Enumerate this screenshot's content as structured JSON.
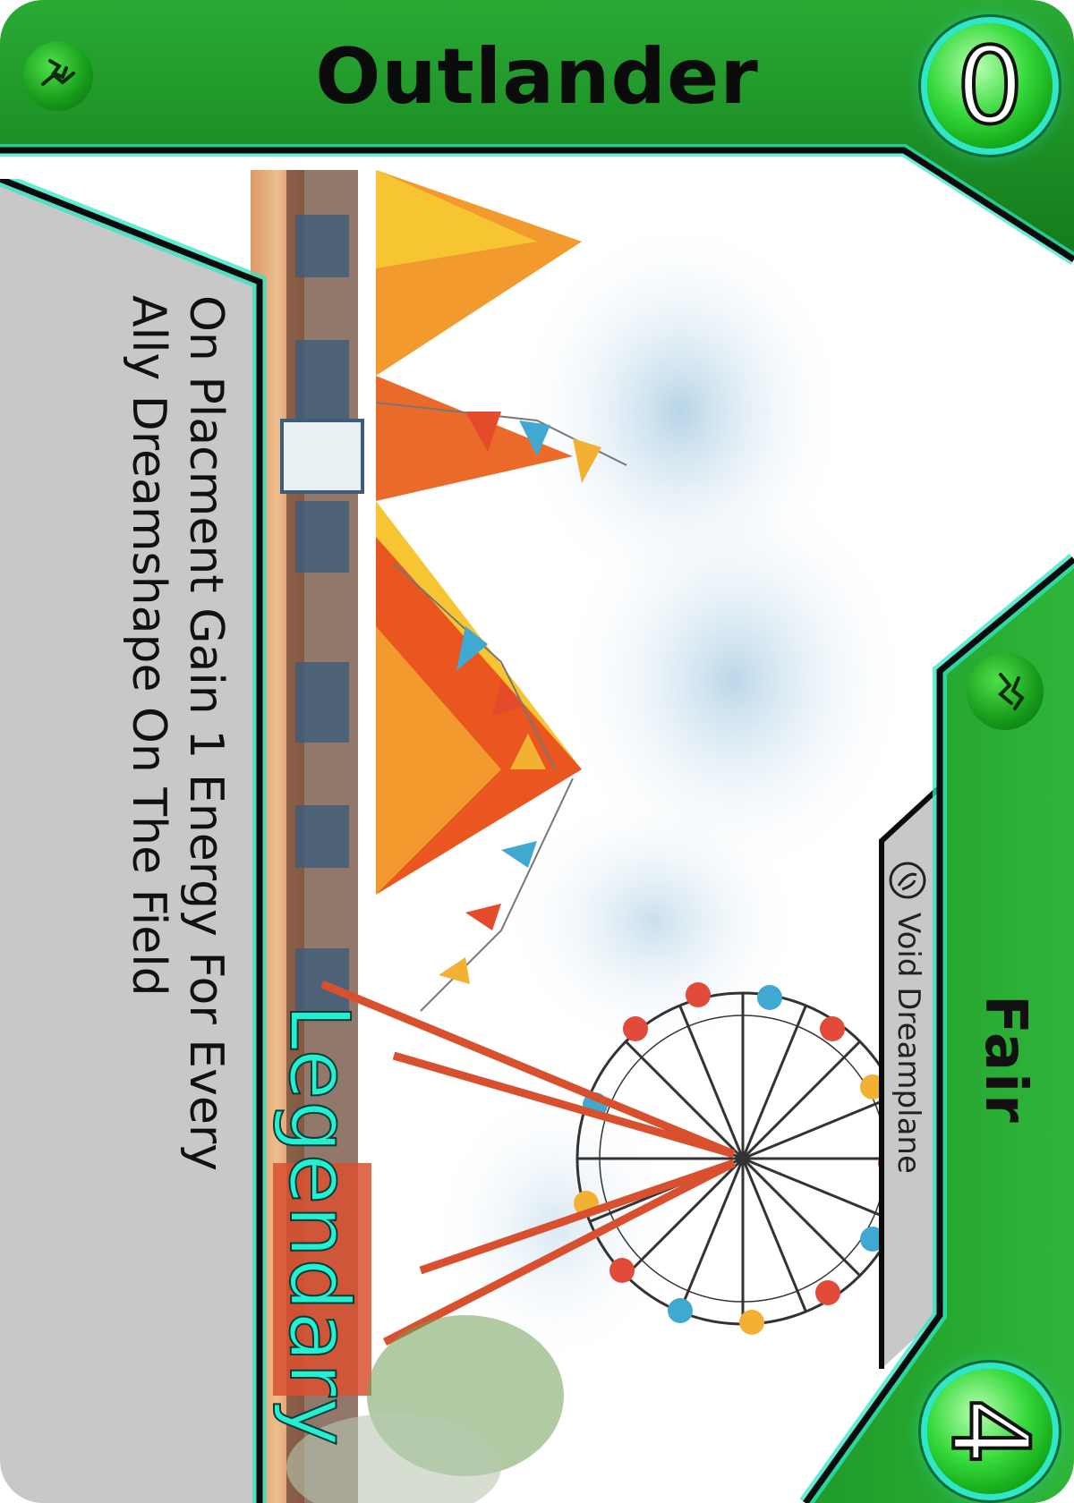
{
  "card": {
    "title": "Outlander",
    "top_cost": "0",
    "bottom_value": "4",
    "ability_lines": [
      "On Placment Gain 1 Energy For Every",
      "Ally Dreamshape On The Field"
    ],
    "rarity": "Legendary",
    "dreamplane": "Void Dreamplane",
    "tier": "Fair"
  },
  "icons": {
    "faction_top": "faction-glyph-icon",
    "faction_side": "faction-glyph-icon",
    "dreamplane": "void-dreamplane-icon"
  },
  "colors": {
    "frame_green": "#1a9a22",
    "frame_dark": "#0a4d10",
    "glow_cyan": "#2fe6c6",
    "text_panel": "#c8c8c8",
    "rarity_text": "#23f0d3"
  },
  "art": {
    "subject": "watercolor-carnival-scene"
  }
}
